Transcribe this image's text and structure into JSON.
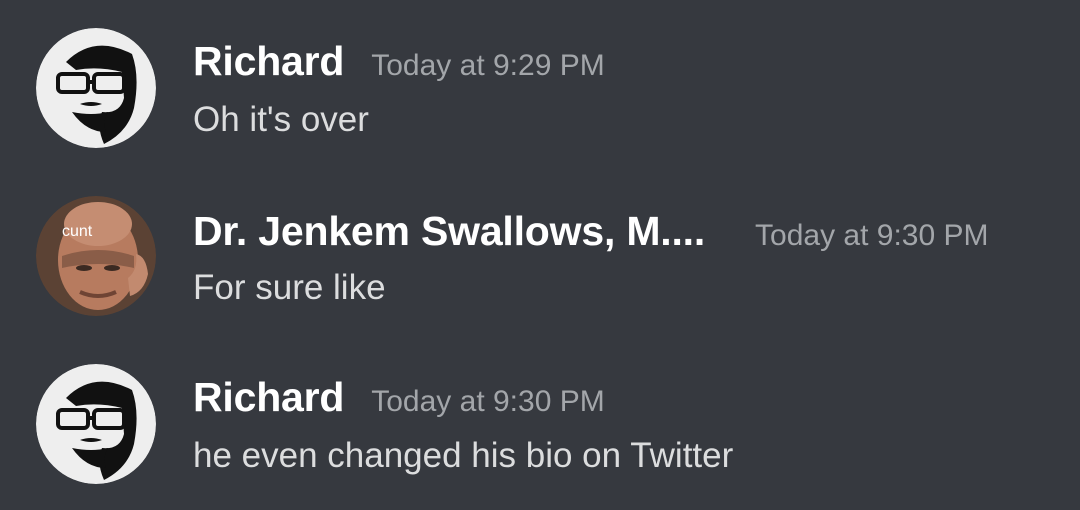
{
  "messages": [
    {
      "author": "Richard",
      "timestamp": "Today at 9:29 PM",
      "content": "Oh it's over",
      "avatar_icon": "bearded-man-glasses-avatar"
    },
    {
      "author": "Dr. Jenkem Swallows, M....",
      "timestamp": "Today at 9:30 PM",
      "content": "For sure like",
      "avatar_icon": "bald-man-photo-avatar",
      "avatar_caption": "cunt"
    },
    {
      "author": "Richard",
      "timestamp": "Today at 9:30 PM",
      "content": "he even changed his bio on Twitter",
      "avatar_icon": "bearded-man-glasses-avatar"
    }
  ],
  "colors": {
    "background": "#36393f",
    "username": "#ffffff",
    "timestamp": "#a3a6aa",
    "message_text": "#dcddde"
  }
}
